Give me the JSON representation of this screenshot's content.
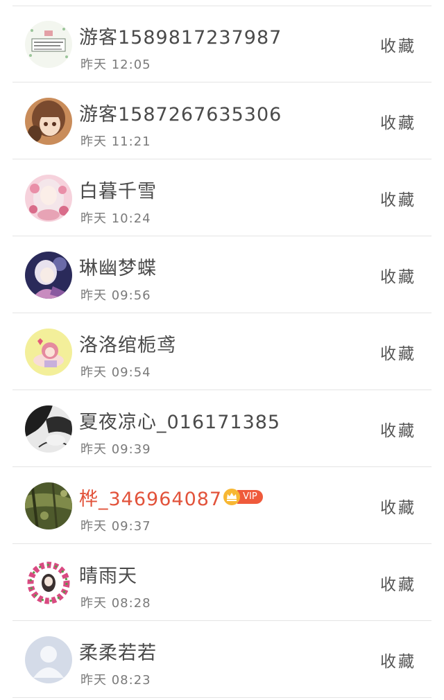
{
  "items": [
    {
      "name": "游客1589817237987",
      "time": "昨天 12:05",
      "action": "收藏",
      "vip": false,
      "avatar": "note-card-avatar"
    },
    {
      "name": "游客1587267635306",
      "time": "昨天 11:21",
      "action": "收藏",
      "vip": false,
      "avatar": "anime-girl-brown-hair-avatar"
    },
    {
      "name": "白暮千雪",
      "time": "昨天 10:24",
      "action": "收藏",
      "vip": false,
      "avatar": "anime-girl-pink-avatar"
    },
    {
      "name": "琳幽梦蝶",
      "time": "昨天 09:56",
      "action": "收藏",
      "vip": false,
      "avatar": "anime-girl-night-avatar"
    },
    {
      "name": "洛洛绾栀鸢",
      "time": "昨天 09:54",
      "action": "收藏",
      "vip": false,
      "avatar": "chibi-yellow-avatar"
    },
    {
      "name": "夏夜凉心_016171385",
      "time": "昨天 09:39",
      "action": "收藏",
      "vip": false,
      "avatar": "bw-sketch-avatar"
    },
    {
      "name": "桦_346964087",
      "time": "昨天 09:37",
      "action": "收藏",
      "vip": true,
      "vip_label": "VIP",
      "avatar": "forest-photo-avatar"
    },
    {
      "name": "晴雨天",
      "time": "昨天 08:28",
      "action": "收藏",
      "vip": false,
      "avatar": "flower-wreath-avatar"
    },
    {
      "name": "柔柔若若",
      "time": "昨天 08:23",
      "action": "收藏",
      "vip": false,
      "avatar": "default-user-avatar"
    }
  ],
  "colors": {
    "name": "#4a4a4a",
    "vip_name": "#e2533b",
    "vip_badge": "#ef5a3b",
    "crown": "#f7b733",
    "time": "#7a7a7a",
    "divider": "#e4e4e4"
  }
}
